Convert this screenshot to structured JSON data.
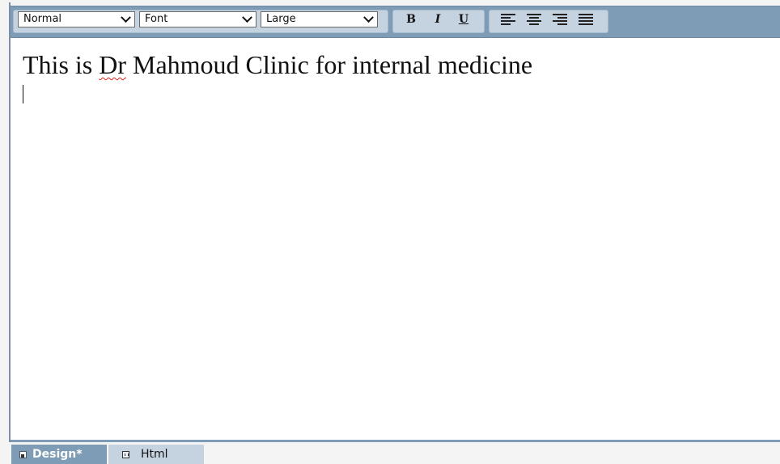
{
  "toolbar": {
    "paragraph_format": "Normal",
    "font_name": "Font",
    "font_size": "Large",
    "bold_label": "B",
    "italic_label": "I",
    "underline_label": "U",
    "align_icons": [
      "align-left-icon",
      "align-center-icon",
      "align-right-icon",
      "align-justify-icon"
    ]
  },
  "editor": {
    "text_before": "This is ",
    "misspelled_word": "Dr",
    "text_after": " Mahmoud Clinic for internal medicine"
  },
  "tabs": {
    "design_label": "Design*",
    "html_label": "Html"
  },
  "colors": {
    "toolbar_bg": "#7f9cb7",
    "group_bg": "#c5d3e1",
    "active_tab": "#7f9cb7",
    "spellcheck": "#e0211a"
  }
}
